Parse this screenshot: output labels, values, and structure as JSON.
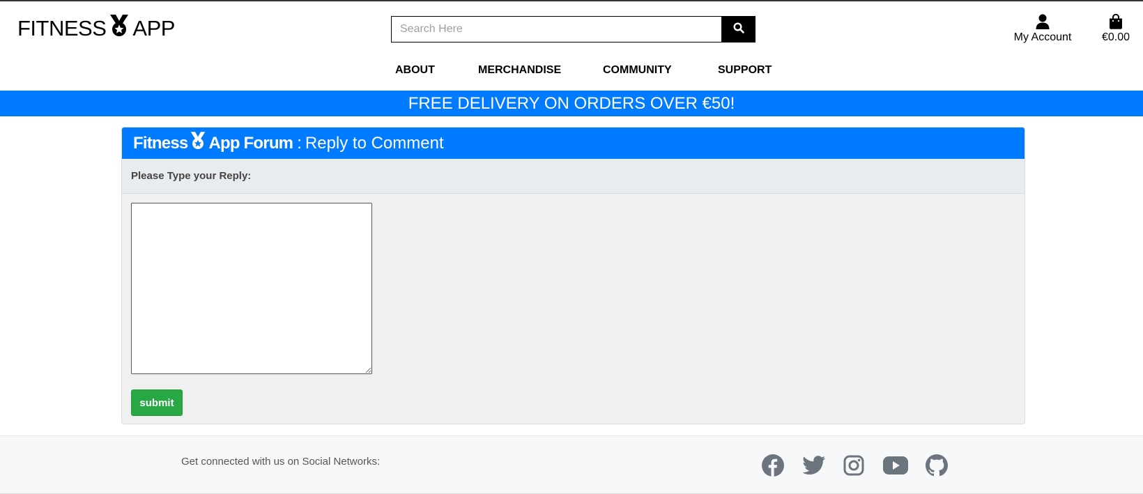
{
  "header": {
    "logo": {
      "word1": "FITNESS",
      "word2": "APP",
      "icon": "medal-icon"
    },
    "search": {
      "placeholder": "Search Here",
      "value": "",
      "button_icon": "search-icon"
    },
    "account": {
      "label": "My Account",
      "icon": "user-icon"
    },
    "cart": {
      "total": "€0.00",
      "icon": "shopping-bag-icon"
    }
  },
  "nav": {
    "items": [
      {
        "label": "ABOUT"
      },
      {
        "label": "MERCHANDISE"
      },
      {
        "label": "COMMUNITY"
      },
      {
        "label": "SUPPORT"
      }
    ]
  },
  "banner": {
    "text": "FREE DELIVERY ON ORDERS OVER €50!"
  },
  "card": {
    "forum_word1": "Fitness",
    "forum_word2": "App Forum",
    "separator": ":",
    "subtitle": "Reply to Comment",
    "prompt": "Please Type your Reply:",
    "reply_value": "",
    "submit_label": "submit"
  },
  "footer": {
    "connect_text": "Get connected with us on Social Networks:",
    "socials": [
      "facebook-icon",
      "twitter-icon",
      "instagram-icon",
      "youtube-icon",
      "github-icon"
    ]
  },
  "colors": {
    "primary_blue": "#007bff",
    "submit_green": "#28a745",
    "card_bg": "#f0f0f0",
    "card_sub_bg": "#e9ecef",
    "footer_bg": "#f7f8fa",
    "social_icon": "#6c757d"
  }
}
